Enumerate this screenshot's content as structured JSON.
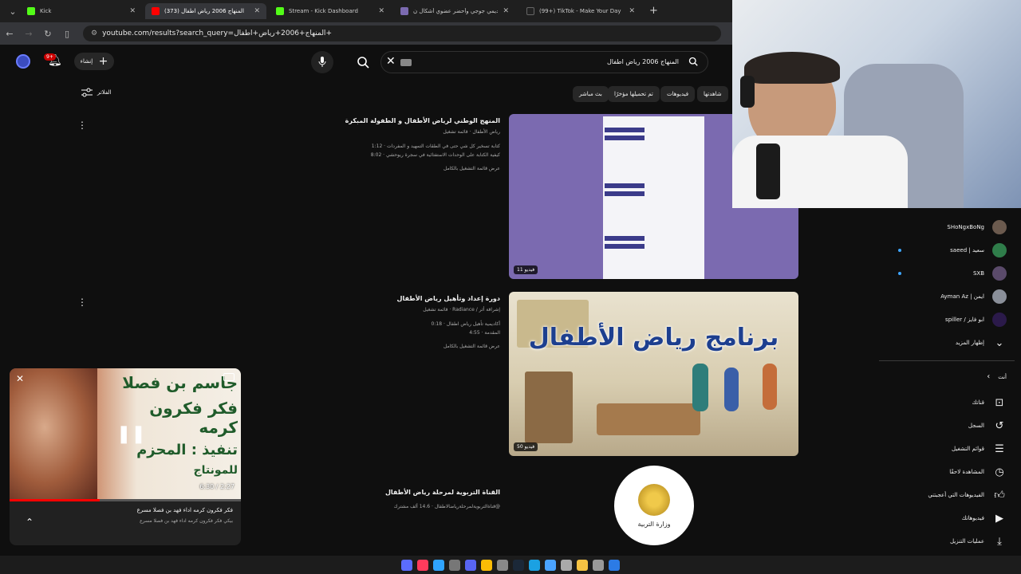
{
  "browser": {
    "tabs": [
      {
        "title": "Kick",
        "active": false
      },
      {
        "title": "(373) المنهاج 2006 رياض اطفال - ube",
        "active": true
      },
      {
        "title": "Stream - Kick Dashboard",
        "active": false
      },
      {
        "title": "عرض تقديمي جوجي وأحضر عضوي أشكال ن",
        "active": false
      },
      {
        "title": "(99+) TikTok - Make Your Day",
        "active": false
      }
    ],
    "url": "youtube.com/results?search_query=المنهاج+2006+رياض+اطفال+"
  },
  "youtube": {
    "create_label": "إنشاء",
    "notif_count": "9+",
    "search_query": "المنهاج 2006 رياض اطفال",
    "filters_label": "الفلاتر",
    "chips": [
      "شاهدتها",
      "فيديوهات",
      "تم تحميلها مؤخرًا",
      "بث مباشر"
    ],
    "results": [
      {
        "title": "المنهج الوطني لرياض الأطفال و الطفولة المبكرة",
        "channel": "رياض الأطفال · قائمة تشغيل",
        "line1": "كتابة تسخير كل شي حتى في الطقات التمهيد و المفردات · 1:12",
        "line2": "كيفية الكتابة على الوحدات الاستفتائية في سجرة ريوحشي · 8:02",
        "full": "عرض قائمة التشغيل بالكامل",
        "count": "11 فيديو"
      },
      {
        "title": "دورة إعداد وتأهيل رياض الأطفال",
        "channel": "إشراقة أثر / Radiance · قائمة تشغيل",
        "line1": "أكاديمية تأهيل رياض اطفال · 0:18",
        "line2": "المقدمة · 4:55",
        "full": "عرض قائمة التشغيل بالكامل",
        "thumb_text": "برنامج رياض الأطفال",
        "count": "50 فيديو"
      },
      {
        "title": "القناة التربوية لمرحلة رياض الأطفال",
        "channel": "@قناةالتربويةلمرحلةرياضالاطفال · 14.6 ألف مشترك",
        "logo_text": "وزارة التربية"
      }
    ],
    "sidebar": {
      "subs": [
        "SHoNgxBoNg",
        "سعيد | saeed",
        "SXB",
        "ايمن | Ayman Az",
        "ابو فايز / spiller"
      ],
      "show_more": "إظهار المزيد",
      "you_header": "أنت",
      "you_items": [
        "قناتك",
        "السجل",
        "قوائم التشغيل",
        "المشاهدة لاحقًا",
        "الفيديوهات التي أعجبتني",
        "فيديوهاتك",
        "عمليات التنزيل"
      ]
    },
    "miniplayer": {
      "time": "6:30 / 2:27",
      "title": "فكر فكرون كرمه اداء فهد بن فصلا مسرع",
      "subtitle": "بيكي فكر فكرون كرمه اداء فهد بن فصلا مسرع",
      "art_line1": "جاسم بن فصلا",
      "art_line2": "فكر فكرون كرمه",
      "art_line3": "تنفيذ : المحزم",
      "art_line4": "للمونتاج",
      "progress": 0.39
    }
  },
  "colors": {
    "accent": "#ff0000",
    "kick": "#53fc18",
    "purple": "#7b6ab0"
  }
}
